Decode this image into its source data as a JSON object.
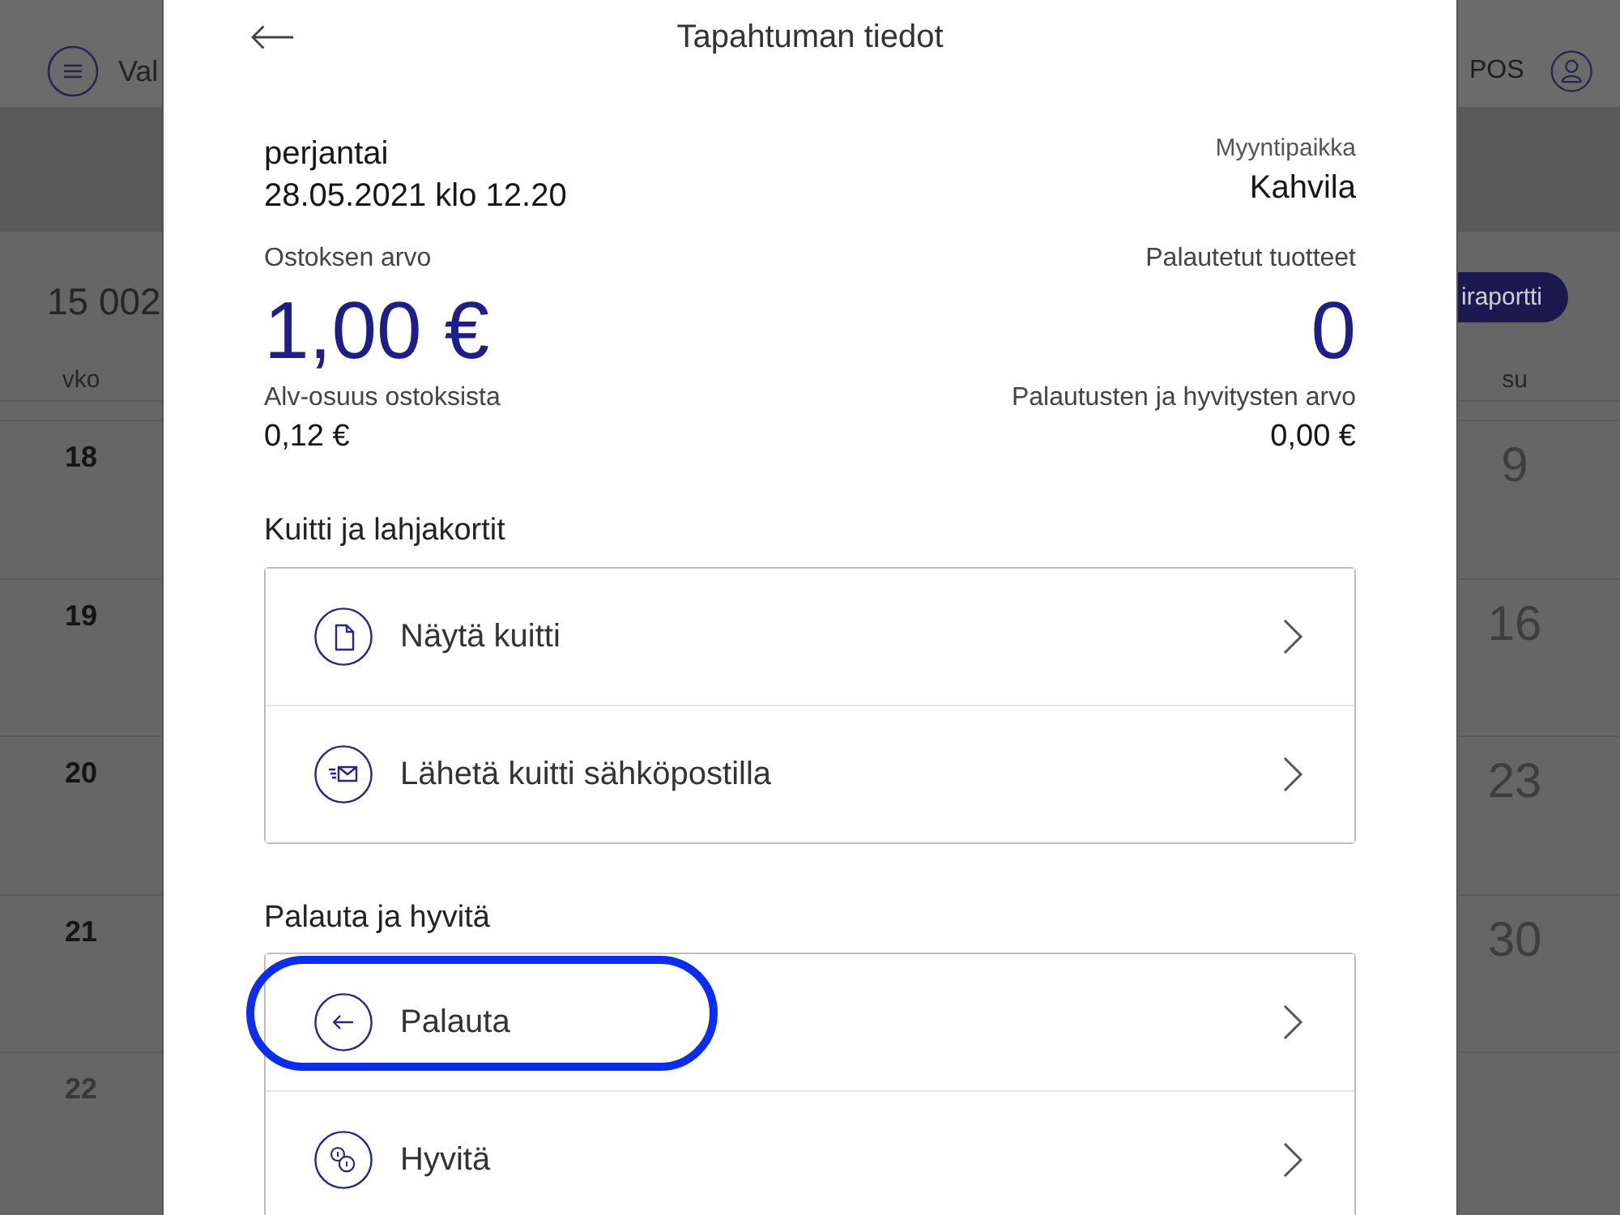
{
  "background": {
    "menu_label": "Val",
    "pos_label": "POS",
    "total": "15 002",
    "report_button": "iraportti",
    "calendar": {
      "week_heading": "vko",
      "sunday_heading": "su",
      "weeks": [
        {
          "week": "18",
          "sunday": "9",
          "muted": false
        },
        {
          "week": "19",
          "sunday": "16",
          "muted": false
        },
        {
          "week": "20",
          "sunday": "23",
          "muted": false
        },
        {
          "week": "21",
          "sunday": "30",
          "muted": false
        },
        {
          "week": "22",
          "muted": true
        }
      ]
    }
  },
  "dialog": {
    "title": "Tapahtuman tiedot",
    "day": "perjantai",
    "datetime": "28.05.2021 klo 12.20",
    "sales_point_label": "Myyntipaikka",
    "sales_point": "Kahvila",
    "purchase_value_label": "Ostoksen arvo",
    "purchase_value": "1,00 €",
    "returned_items_label": "Palautetut tuotteet",
    "returned_items": "0",
    "vat_label": "Alv-osuus ostoksista",
    "vat": "0,12 €",
    "refunds_label": "Palautusten ja hyvitysten arvo",
    "refunds": "0,00 €"
  },
  "sections": [
    {
      "title": "Kuitti ja lahjakortit",
      "items": [
        {
          "label": "Näytä kuitti",
          "kind": "receipt",
          "highlighted": false
        },
        {
          "label": "Lähetä kuitti sähköpostilla",
          "kind": "email",
          "highlighted": false
        }
      ]
    },
    {
      "title": "Palauta ja hyvitä",
      "items": [
        {
          "label": "Palauta",
          "kind": "return",
          "highlighted": true
        },
        {
          "label": "Hyvitä",
          "kind": "refund",
          "highlighted": false
        }
      ]
    }
  ]
}
